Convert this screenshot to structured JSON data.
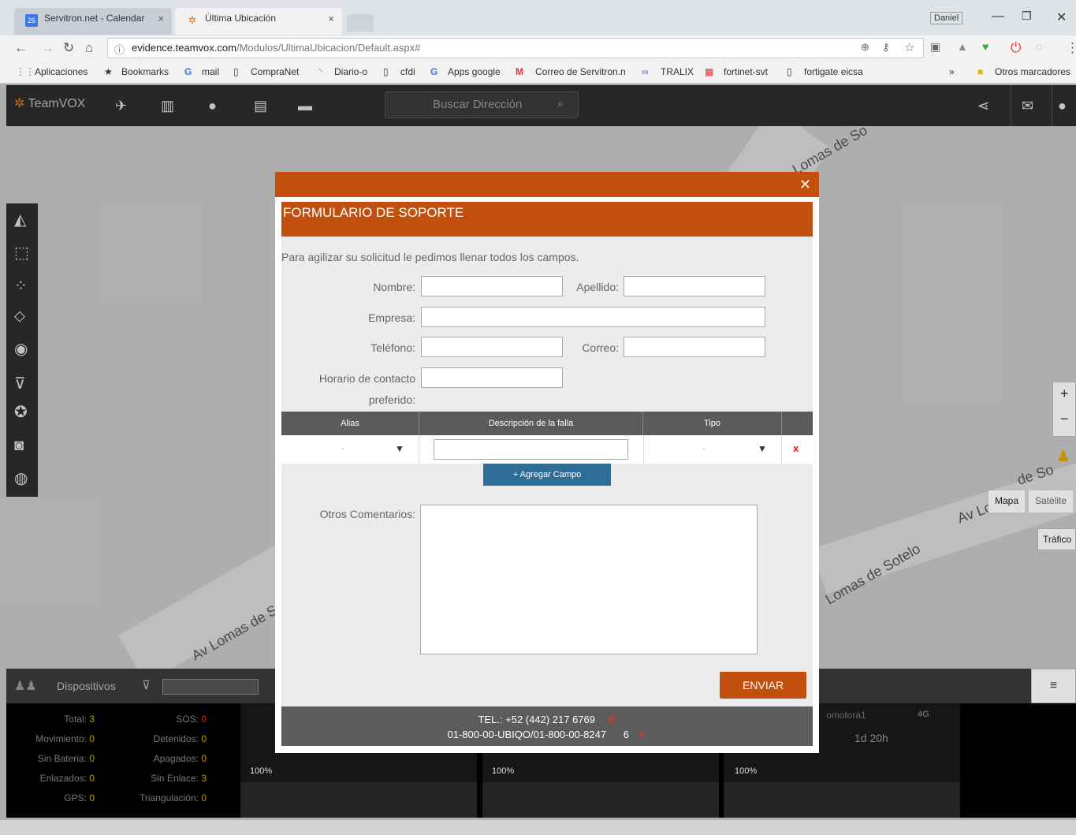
{
  "browser": {
    "tabs": [
      {
        "label": "Servitron.net - Calendar",
        "icon": "calendar-icon",
        "badge": "26"
      },
      {
        "label": "Última Ubicación",
        "icon": "teamvox-favicon-icon"
      }
    ],
    "user": "Daniel",
    "url": {
      "host": "evidence.teamvox.com",
      "path": "/Modulos/UltimaUbicacion/Default.aspx#"
    },
    "bookmarks": [
      "Aplicaciones",
      "Bookmarks",
      "mail",
      "CompraNet",
      "Diario-o",
      "cfdi",
      "Apps google",
      "Correo de Servitron.n",
      "TRALIX",
      "fortinet-svt",
      "fortigate eicsa",
      "»",
      "Otros marcadores"
    ]
  },
  "app": {
    "logo": "TeamVOX",
    "search_placeholder": "Buscar Dirección",
    "map": {
      "roads": [
        "Lomas de So",
        "Av Lomas de So",
        "Lomas de Sotelo",
        "Av Lo",
        "de So"
      ],
      "map_type": [
        "Mapa",
        "Satélite"
      ],
      "traffic": "Tráfico"
    },
    "devices": {
      "label": "Dispositivos",
      "stats_left": [
        {
          "label": "Total:",
          "value": "3"
        },
        {
          "label": "Movimiento:",
          "value": "0"
        },
        {
          "label": "Sin Bateria:",
          "value": "0"
        },
        {
          "label": "Enlazados:",
          "value": "0"
        },
        {
          "label": "GPS:",
          "value": "0"
        }
      ],
      "stats_right": [
        {
          "label": "SOS:",
          "value": "0"
        },
        {
          "label": "Detenidos:",
          "value": "0"
        },
        {
          "label": "Apagados:",
          "value": "0"
        },
        {
          "label": "Sin Enlace:",
          "value": "3"
        },
        {
          "label": "Triangulación:",
          "value": "0"
        }
      ],
      "cards": [
        {
          "battery": "100%"
        },
        {
          "battery": "100%"
        },
        {
          "battery": "100%",
          "name": "omotora1",
          "time": "1d 20h",
          "network": "4G"
        }
      ]
    }
  },
  "modal": {
    "form_title": "FORMULARIO DE SOPORTE",
    "intro": "Para agilizar su solicitud le pedimos llenar todos los campos.",
    "fields": {
      "nombre": "Nombre:",
      "apellido": "Apellido:",
      "empresa": "Empresa:",
      "telefono": "Teléfono:",
      "correo": "Correo:",
      "horario_1": "Horario de contacto",
      "horario_2": "preferido:"
    },
    "table": {
      "headers": [
        "Alias",
        "Descripción de la falla",
        "Tipo"
      ],
      "row": {
        "alias": "-",
        "tipo": "-",
        "remove": "x"
      }
    },
    "add_button": "+ Agregar Campo",
    "comments_label": "Otros Comentarios:",
    "send_button": "ENVIAR",
    "footer_tel": "TEL.: +52 (442) 217 6769",
    "footer_line2": "01-800-00-UBIQO/01-800-00-8247",
    "footer_suffix": "6"
  }
}
